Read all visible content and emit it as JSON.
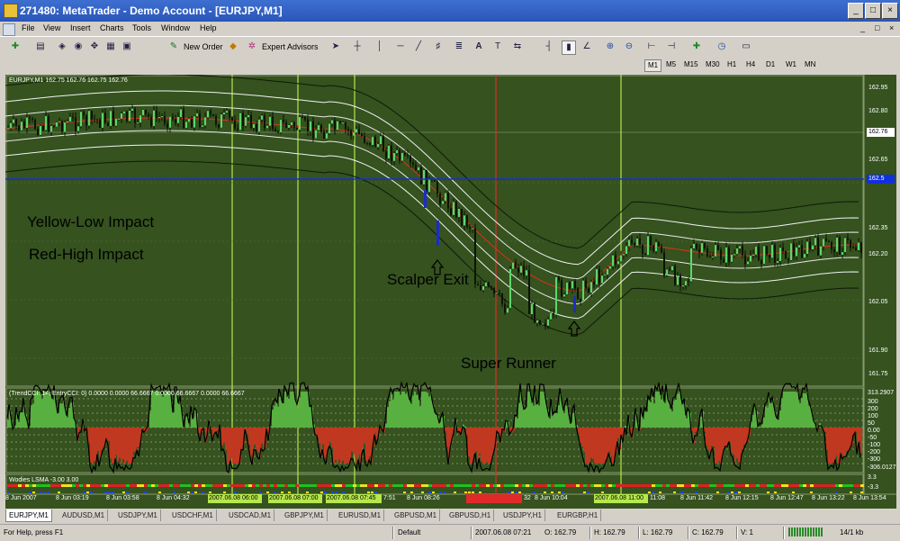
{
  "window": {
    "title": "271480: MetaTrader - Demo Account - [EURJPY,M1]"
  },
  "menu": [
    "File",
    "View",
    "Insert",
    "Charts",
    "Tools",
    "Window",
    "Help"
  ],
  "toolbar": {
    "new_order": "New Order",
    "expert_advisors": "Expert Advisors"
  },
  "timeframes": [
    "M1",
    "M5",
    "M15",
    "M30",
    "H1",
    "H4",
    "D1",
    "W1",
    "MN"
  ],
  "active_timeframe": "M1",
  "chart": {
    "symbol_header": "EURJPY,M1  162.75 162.76 162.75 162.76",
    "price_labels": [
      "162.95",
      "162.80",
      "162.76",
      "162.65",
      "162.50",
      "162.35",
      "162.20",
      "162.05",
      "161.90",
      "161.75"
    ],
    "current_price": "162.76",
    "hline_label": "162.5",
    "annotations": {
      "yellow": "Yellow-Low Impact",
      "red": "Red-High Impact",
      "scalper": "Scalper Exit",
      "runner": "Super Runner"
    },
    "cci_header": "(TrendCCI: 14, EntryCCI: 0)  0.0000 0.0000 66.6667 0.0000 66.6667 0.0000 66.6667",
    "cci_labels": [
      "313.2907",
      "300",
      "200",
      "100",
      "50",
      "0.00",
      "-50",
      "-100",
      "-200",
      "-300",
      "-306.0127"
    ],
    "wlsma_header": "Wodies LSMA -3.00 3.00",
    "wlsma_labels": [
      "3.3",
      "-3.3"
    ],
    "time_labels": [
      "8 Jun 2007",
      "8 Jun 03:19",
      "8 Jun 03:58",
      "8 Jun 04:32",
      "2007.06.08 06:00",
      "2007.06.08 07:00",
      "2007.06.08 07:45",
      "7:51",
      "8 Jun 08:26",
      "32",
      "8 Jun 10:04",
      "2007.06.08 11:00",
      "11:08",
      "8 Jun 11:42",
      "8 Jun 12:15",
      "8 Jun 12:47",
      "8 Jun 13:22",
      "8 Jun 13:54"
    ],
    "colors": {
      "background": "#35521f",
      "grid": "#5a7040",
      "low_impact": "#b6e84c",
      "high_impact": "#e02a2a",
      "hline": "#1030e0",
      "bull": "#5cd66a",
      "bear": "#c02a20"
    }
  },
  "tabs": [
    "EURJPY,M1",
    "AUDUSD,M1",
    "USDJPY,M1",
    "USDCHF,M1",
    "USDCAD,M1",
    "GBPJPY,M1",
    "EURUSD,M1",
    "GBPUSD,M1",
    "GBPUSD,H1",
    "USDJPY,H1",
    "EURGBP,H1"
  ],
  "active_tab": "EURJPY,M1",
  "status": {
    "help": "For Help, press F1",
    "profile": "Default",
    "datetime": "2007.06.08 07:21",
    "open": "O: 162.79",
    "high": "H: 162.79",
    "low": "L: 162.79",
    "close": "C: 162.79",
    "volume": "V: 1",
    "traffic": "14/1 kb"
  }
}
